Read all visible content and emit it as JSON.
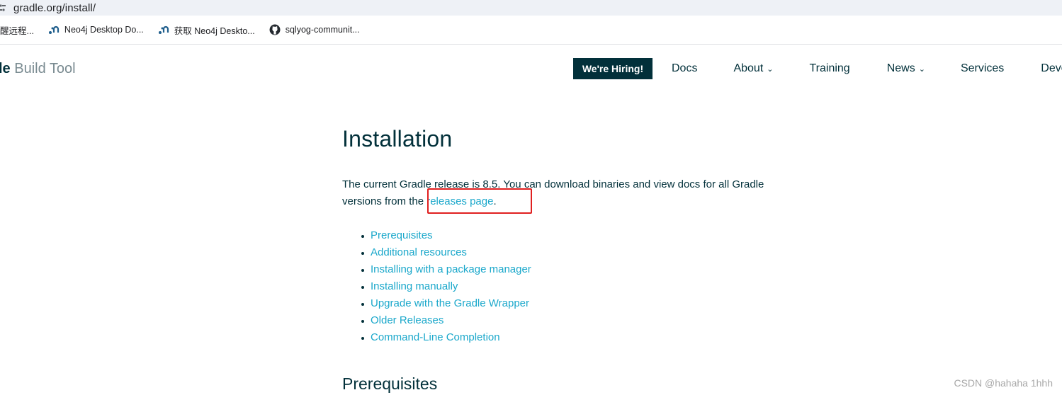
{
  "browser": {
    "url": "gradle.org/install/"
  },
  "bookmarks": [
    {
      "label": "醒远程...",
      "icon": "none"
    },
    {
      "label": "Neo4j Desktop Do...",
      "icon": "neo4j-icon"
    },
    {
      "label": "获取 Neo4j Deskto...",
      "icon": "neo4j-icon"
    },
    {
      "label": "sqlyog-communit...",
      "icon": "github-icon"
    }
  ],
  "header": {
    "logo_strong": "le",
    "logo_rest": " Build Tool",
    "hiring": "We're Hiring!",
    "nav": {
      "docs": "Docs",
      "about": "About",
      "training": "Training",
      "news": "News",
      "services": "Services",
      "develocity": "Deve"
    }
  },
  "main": {
    "title": "Installation",
    "intro_part1": "The current Gradle release is 8.5. You can download binaries and view docs for all Gradle versions from the ",
    "intro_link": "releases page",
    "intro_part2": ".",
    "toc": [
      "Prerequisites",
      "Additional resources",
      "Installing with a package manager",
      "Installing manually",
      "Upgrade with the Gradle Wrapper",
      "Older Releases",
      "Command-Line Completion"
    ],
    "section_title": "Prerequisites"
  },
  "watermark": "CSDN @hahaha 1hhh",
  "colors": {
    "brand_dark": "#02303a",
    "link": "#1ba8cb",
    "highlight": "#e02020"
  }
}
